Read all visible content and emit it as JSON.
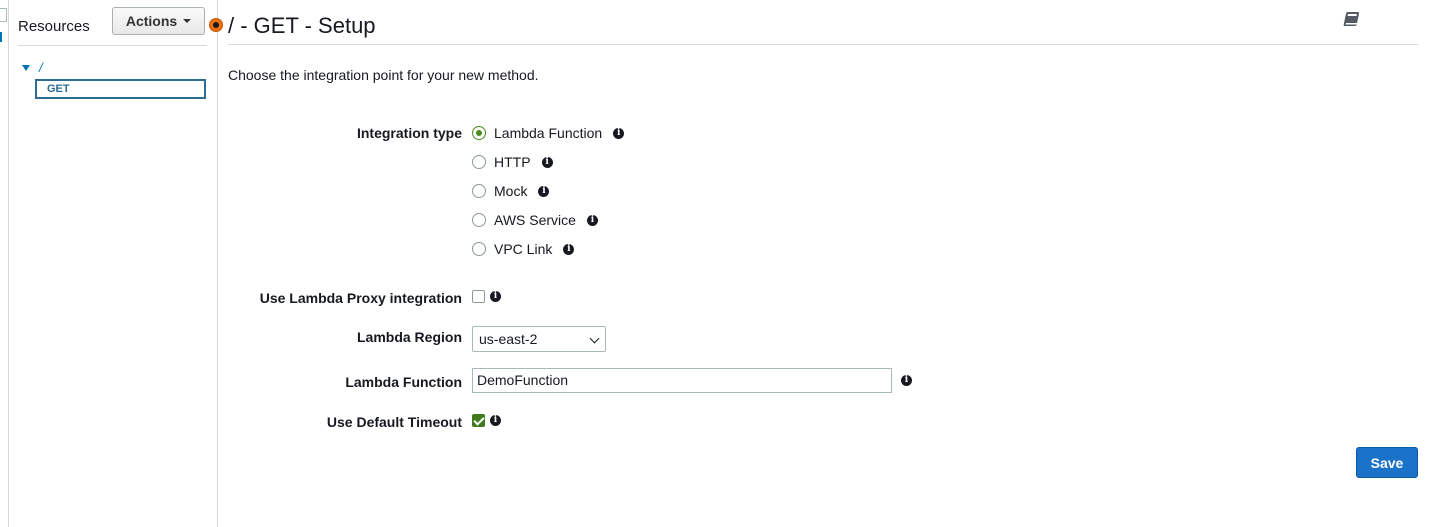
{
  "resources": {
    "title": "Resources",
    "actions_label": "Actions",
    "tree_root": "/",
    "tree_selected_method": "GET"
  },
  "main": {
    "title": "/ - GET - Setup",
    "intro": "Choose the integration point for your new method."
  },
  "form": {
    "integration_type_label": "Integration type",
    "integration_options": [
      {
        "label": "Lambda Function",
        "selected": true
      },
      {
        "label": "HTTP",
        "selected": false
      },
      {
        "label": "Mock",
        "selected": false
      },
      {
        "label": "AWS Service",
        "selected": false
      },
      {
        "label": "VPC Link",
        "selected": false
      }
    ],
    "proxy_label": "Use Lambda Proxy integration",
    "proxy_checked": false,
    "region_label": "Lambda Region",
    "region_value": "us-east-2",
    "function_label": "Lambda Function",
    "function_value": "DemoFunction",
    "timeout_label": "Use Default Timeout",
    "timeout_checked": true,
    "save_label": "Save"
  },
  "icons": {
    "info": "info-icon",
    "book": "book-icon",
    "collapse_handle": "collapse-handle-icon"
  },
  "colors": {
    "accent_blue": "#0073bb",
    "primary_button": "#1a73c8",
    "checked_green": "#3f7a1f",
    "handle_orange": "#ec7211"
  }
}
